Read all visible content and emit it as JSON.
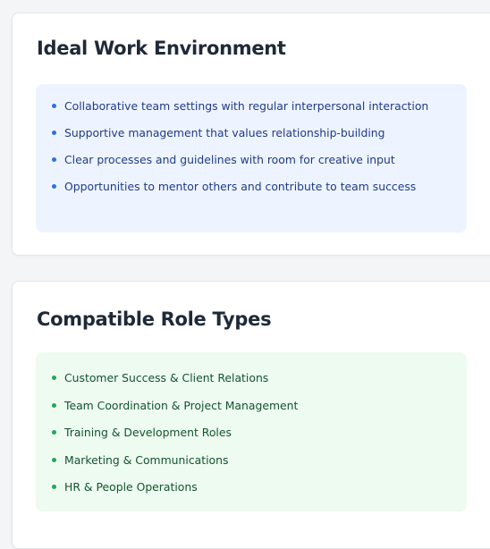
{
  "colors": {
    "blue_panel_bg": "#eef4ff",
    "blue_text": "#1e3a8a",
    "blue_bullet": "#2f6fe4",
    "green_panel_bg": "#edfbf1",
    "green_text": "#14532d",
    "green_bullet": "#22a65a"
  },
  "sections": [
    {
      "title": "Ideal Work Environment",
      "bullet_icon": "dot-bullet-icon",
      "items": [
        "Collaborative team settings with regular interpersonal interaction",
        "Supportive management that values relationship-building",
        "Clear processes and guidelines with room for creative input",
        "Opportunities to mentor others and contribute to team success"
      ]
    },
    {
      "title": "Compatible Role Types",
      "bullet_icon": "dot-bullet-icon",
      "items": [
        "Customer Success & Client Relations",
        "Team Coordination & Project Management",
        "Training & Development Roles",
        "Marketing & Communications",
        "HR & People Operations"
      ]
    }
  ]
}
